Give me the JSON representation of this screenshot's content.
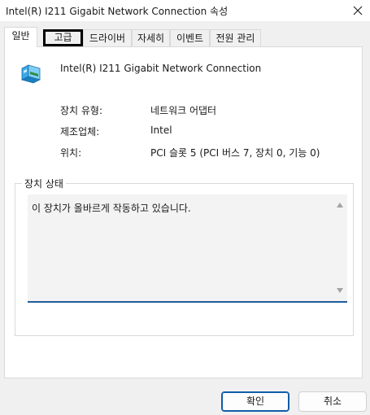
{
  "window": {
    "title": "Intel(R) I211 Gigabit Network Connection 속성",
    "close_icon": "close-icon"
  },
  "tabs": [
    {
      "label": "일반"
    },
    {
      "label": "고급"
    },
    {
      "label": "드라이버"
    },
    {
      "label": "자세히"
    },
    {
      "label": "이벤트"
    },
    {
      "label": "전원 관리"
    }
  ],
  "general": {
    "device_icon": "network-adapter-icon",
    "device_name": "Intel(R) I211 Gigabit Network Connection",
    "rows": [
      {
        "label": "장치 유형:",
        "value": "네트워크 어댑터"
      },
      {
        "label": "제조업체:",
        "value": "Intel"
      },
      {
        "label": "위치:",
        "value": "PCI 슬롯 5 (PCI 버스 7, 장치 0, 기능 0)"
      }
    ],
    "status_group_title": "장치 상태",
    "status_text": "이 장치가 올바르게 작동하고 있습니다."
  },
  "buttons": {
    "ok": "확인",
    "cancel": "취소"
  }
}
